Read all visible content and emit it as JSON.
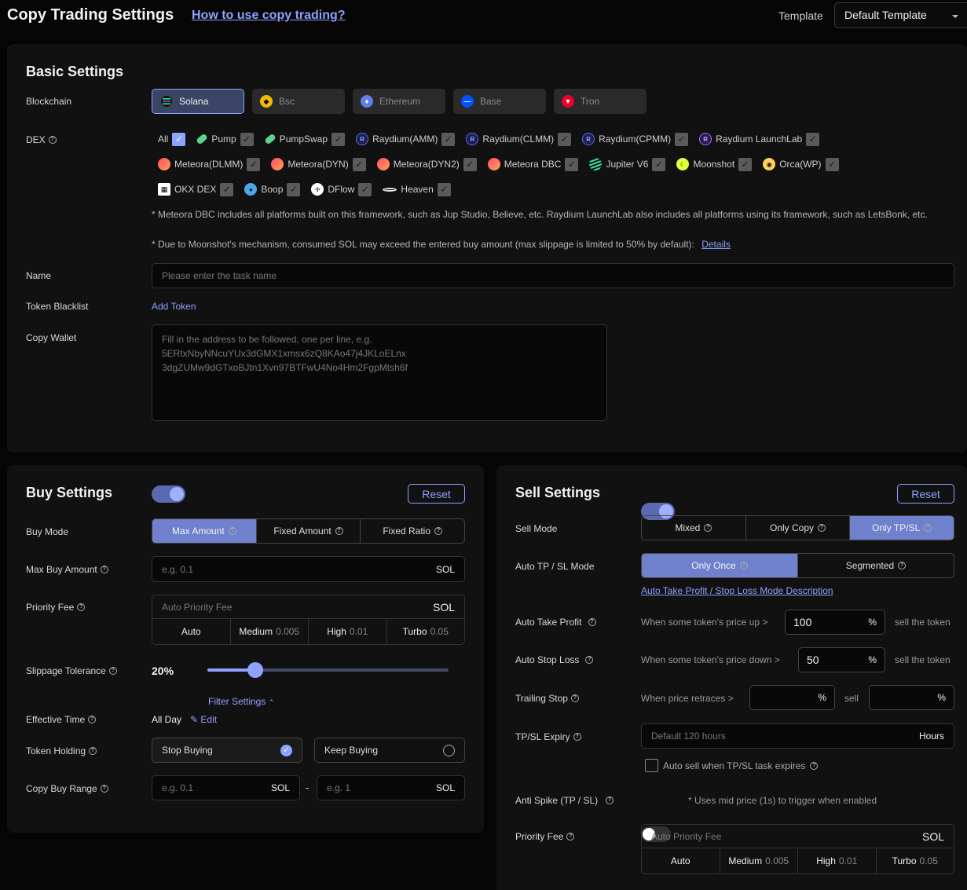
{
  "header": {
    "title": "Copy Trading Settings",
    "howto": "How to use copy trading?",
    "template_label": "Template",
    "template_value": "Default Template"
  },
  "basic": {
    "title": "Basic Settings",
    "blockchain_label": "Blockchain",
    "chains": [
      {
        "name": "Solana",
        "icon": "solana-icon",
        "color": "#1a1a1a"
      },
      {
        "name": "Bsc",
        "icon": "bnb-icon",
        "color": "#f0b90b"
      },
      {
        "name": "Ethereum",
        "icon": "ethereum-icon",
        "color": "#627eea"
      },
      {
        "name": "Base",
        "icon": "base-icon",
        "color": "#0052ff"
      },
      {
        "name": "Tron",
        "icon": "tron-icon",
        "color": "#eb0029"
      }
    ],
    "dex_label": "DEX",
    "dex_rows": [
      [
        "All",
        "Pump",
        "PumpSwap",
        "Raydium(AMM)",
        "Raydium(CLMM)",
        "Raydium(CPMM)",
        "Raydium LaunchLab"
      ],
      [
        "Meteora(DLMM)",
        "Meteora(DYN)",
        "Meteora(DYN2)",
        "Meteora DBC",
        "Jupiter V6",
        "Moonshot",
        "Orca(WP)"
      ],
      [
        "OKX DEX",
        "Boop",
        "DFlow",
        "Heaven"
      ]
    ],
    "note1": "* Meteora DBC includes all platforms built on this framework, such as Jup Studio, Believe, etc. Raydium LaunchLab also includes all platforms using its framework, such as LetsBonk, etc.",
    "note2": "* Due to Moonshot's mechanism, consumed SOL may exceed the entered buy amount (max slippage is limited to 50% by default):",
    "details": "Details",
    "name_label": "Name",
    "name_placeholder": "Please enter the task name",
    "blacklist_label": "Token Blacklist",
    "add_token": "Add Token",
    "wallet_label": "Copy Wallet",
    "wallet_placeholder_1": "Fill in the address to be followed, one per line, e.g.",
    "wallet_placeholder_2": "5ERtxNbyNNcuYUx3dGMX1xmsx6zQ8KAo47j4JKLoELnx",
    "wallet_placeholder_3": "3dgZUMw9dGTxoBJtn1Xvn97BTFwU4No4Hm2FgpMtsh6f"
  },
  "buy": {
    "title": "Buy Settings",
    "reset": "Reset",
    "mode_label": "Buy Mode",
    "modes": [
      "Max Amount",
      "Fixed Amount",
      "Fixed Ratio"
    ],
    "max_label": "Max Buy Amount",
    "max_placeholder": "e.g. 0.1",
    "unit": "SOL",
    "fee_label": "Priority Fee",
    "fee_placeholder": "Auto Priority Fee",
    "fee_opts": [
      {
        "name": "Auto",
        "val": ""
      },
      {
        "name": "Medium",
        "val": "0.005"
      },
      {
        "name": "High",
        "val": "0.01"
      },
      {
        "name": "Turbo",
        "val": "0.05"
      }
    ],
    "slippage_label": "Slippage Tolerance",
    "slippage_value": "20%",
    "slippage_fraction": 0.2,
    "filter": "Filter Settings",
    "time_label": "Effective Time",
    "time_value": "All Day",
    "edit": "Edit",
    "holding_label": "Token Holding",
    "stop_buying": "Stop Buying",
    "keep_buying": "Keep Buying",
    "range_label": "Copy Buy Range",
    "range_min_ph": "e.g. 0.1",
    "range_max_ph": "e.g. 1",
    "dash": "-"
  },
  "sell": {
    "title": "Sell Settings",
    "reset": "Reset",
    "mode_label": "Sell Mode",
    "modes": [
      "Mixed",
      "Only Copy",
      "Only TP/SL"
    ],
    "tpsl_label": "Auto TP / SL Mode",
    "tpsl_modes": [
      "Only Once",
      "Segmented"
    ],
    "tpsl_desc": "Auto Take Profit / Stop Loss Mode Description",
    "tp_label": "Auto Take Profit",
    "tp_text": "When some token's price up >",
    "tp_value": "100",
    "sl_label": "Auto Stop Loss",
    "sl_text": "When some token's price down >",
    "sl_value": "50",
    "pct": "%",
    "sell_token": "sell the token",
    "trailing_label": "Trailing Stop",
    "trailing_text": "When price retraces >",
    "sell_word": "sell",
    "expiry_label": "TP/SL Expiry",
    "expiry_placeholder": "Default 120 hours",
    "hours": "Hours",
    "auto_sell": "Auto sell when TP/SL task expires",
    "spike_label": "Anti Spike (TP / SL)",
    "spike_note": "* Uses mid price (1s) to trigger when enabled",
    "fee_label": "Priority Fee",
    "fee_placeholder": "Auto Priority Fee",
    "unit": "SOL",
    "fee_opts": [
      {
        "name": "Auto",
        "val": ""
      },
      {
        "name": "Medium",
        "val": "0.005"
      },
      {
        "name": "High",
        "val": "0.01"
      },
      {
        "name": "Turbo",
        "val": "0.05"
      }
    ]
  }
}
